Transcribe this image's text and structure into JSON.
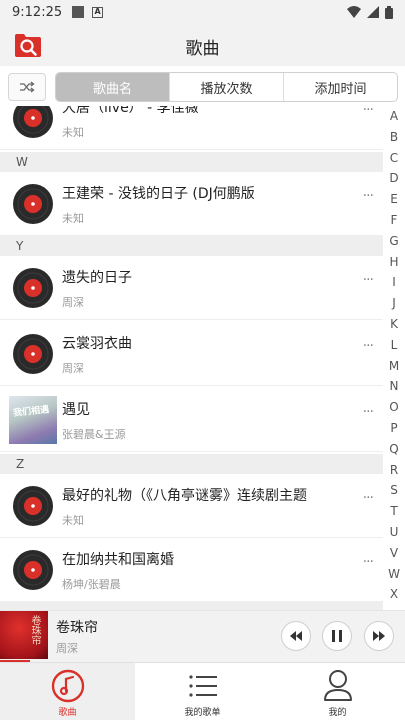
{
  "status_bar": {
    "time": "9:12:25"
  },
  "header": {
    "title": "歌曲"
  },
  "sort_tabs": [
    "歌曲名",
    "播放次数",
    "添加时间"
  ],
  "songs_partial_top": {
    "name": "大居（live） - 李佳薇",
    "artist": "未知"
  },
  "sections": [
    {
      "letter": "W",
      "songs": [
        {
          "name": "王建荣 - 没钱的日子 (DJ何鹏版",
          "artist": "未知",
          "art": "disc"
        }
      ]
    },
    {
      "letter": "Y",
      "songs": [
        {
          "name": "遗失的日子",
          "artist": "周深",
          "art": "disc"
        },
        {
          "name": "云裳羽衣曲",
          "artist": "周深",
          "art": "disc"
        },
        {
          "name": "遇见",
          "artist": "张碧晨&王源",
          "art": "cover"
        }
      ]
    },
    {
      "letter": "Z",
      "songs": [
        {
          "name": "最好的礼物（《八角亭谜雾》连续剧主题",
          "artist": "未知",
          "art": "disc"
        },
        {
          "name": "在加纳共和国离婚",
          "artist": "杨坤/张碧晨",
          "art": "disc"
        }
      ]
    }
  ],
  "row_more": "···",
  "cover_text": "我们相遇",
  "alphabet": [
    "A",
    "B",
    "C",
    "D",
    "E",
    "F",
    "G",
    "H",
    "I",
    "J",
    "K",
    "L",
    "M",
    "N",
    "O",
    "P",
    "Q",
    "R",
    "S",
    "T",
    "U",
    "V",
    "W",
    "X"
  ],
  "player": {
    "title": "卷珠帘",
    "artist": "周深",
    "art_text": "卷珠帘"
  },
  "tabs": [
    {
      "label": "歌曲",
      "icon": "music-note-icon",
      "active": true
    },
    {
      "label": "我的歌单",
      "icon": "list-icon",
      "active": false
    },
    {
      "label": "我的",
      "icon": "person-icon",
      "active": false
    }
  ],
  "colors": {
    "accent": "#d9312a",
    "header_bg": "#f2f2f2",
    "selected_tab_bg": "#bdbdbd"
  }
}
